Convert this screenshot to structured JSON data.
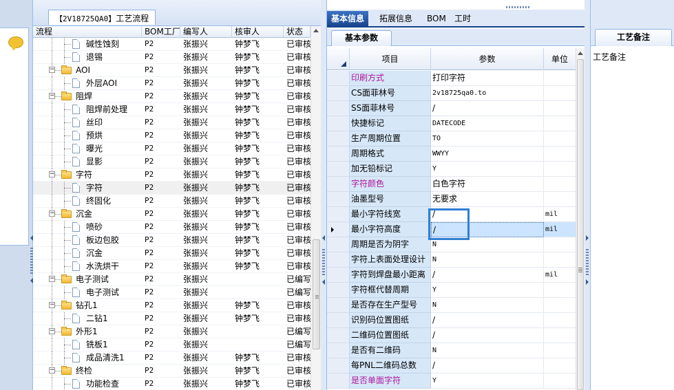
{
  "process_panel": {
    "tab_code": "【2V18725QA0】",
    "tab_label": "工艺流程",
    "columns": [
      "流程",
      "BOM工厂",
      "编写人",
      "核审人",
      "状态"
    ],
    "rows": [
      {
        "name": "碱性蚀刻",
        "type": "doc",
        "bom": "P2",
        "writer": "张振兴",
        "reviewer": "钟梦飞",
        "status": "已审核"
      },
      {
        "name": "退锡",
        "type": "doc",
        "bom": "P2",
        "writer": "张振兴",
        "reviewer": "钟梦飞",
        "status": "已审核"
      },
      {
        "name": "AOI",
        "type": "folder",
        "bom": "P2",
        "writer": "张振兴",
        "reviewer": "钟梦飞",
        "status": "已审核"
      },
      {
        "name": "外层AOI",
        "type": "doc",
        "bom": "P2",
        "writer": "张振兴",
        "reviewer": "钟梦飞",
        "status": "已审核"
      },
      {
        "name": "阻焊",
        "type": "folder",
        "bom": "P2",
        "writer": "张振兴",
        "reviewer": "钟梦飞",
        "status": "已审核"
      },
      {
        "name": "阻焊前处理",
        "type": "doc",
        "bom": "P2",
        "writer": "张振兴",
        "reviewer": "钟梦飞",
        "status": "已审核"
      },
      {
        "name": "丝印",
        "type": "doc",
        "bom": "P2",
        "writer": "张振兴",
        "reviewer": "钟梦飞",
        "status": "已审核"
      },
      {
        "name": "预烘",
        "type": "doc",
        "bom": "P2",
        "writer": "张振兴",
        "reviewer": "钟梦飞",
        "status": "已审核"
      },
      {
        "name": "曝光",
        "type": "doc",
        "bom": "P2",
        "writer": "张振兴",
        "reviewer": "钟梦飞",
        "status": "已审核"
      },
      {
        "name": "显影",
        "type": "doc",
        "bom": "P2",
        "writer": "张振兴",
        "reviewer": "钟梦飞",
        "status": "已审核"
      },
      {
        "name": "字符",
        "type": "folder",
        "bom": "P2",
        "writer": "张振兴",
        "reviewer": "钟梦飞",
        "status": "已审核"
      },
      {
        "name": "字符",
        "type": "doc",
        "bom": "P2",
        "writer": "张振兴",
        "reviewer": "钟梦飞",
        "status": "已审核",
        "selected": true
      },
      {
        "name": "终固化",
        "type": "doc",
        "bom": "P2",
        "writer": "张振兴",
        "reviewer": "钟梦飞",
        "status": "已审核"
      },
      {
        "name": "沉金",
        "type": "folder",
        "bom": "P2",
        "writer": "张振兴",
        "reviewer": "钟梦飞",
        "status": "已审核"
      },
      {
        "name": "喷砂",
        "type": "doc",
        "bom": "P2",
        "writer": "张振兴",
        "reviewer": "钟梦飞",
        "status": "已审核"
      },
      {
        "name": "板边包胶",
        "type": "doc",
        "bom": "P2",
        "writer": "张振兴",
        "reviewer": "钟梦飞",
        "status": "已审核"
      },
      {
        "name": "沉金",
        "type": "doc",
        "bom": "P2",
        "writer": "张振兴",
        "reviewer": "钟梦飞",
        "status": "已审核"
      },
      {
        "name": "水洗烘干",
        "type": "doc",
        "bom": "P2",
        "writer": "张振兴",
        "reviewer": "钟梦飞",
        "status": "已审核"
      },
      {
        "name": "电子测试",
        "type": "folder",
        "bom": "P2",
        "writer": "张振兴",
        "reviewer": "",
        "status": "已编写"
      },
      {
        "name": "电子测试",
        "type": "doc",
        "bom": "P2",
        "writer": "张振兴",
        "reviewer": "",
        "status": "已编写"
      },
      {
        "name": "钻孔1",
        "type": "folder",
        "bom": "P2",
        "writer": "张振兴",
        "reviewer": "钟梦飞",
        "status": "已审核"
      },
      {
        "name": "二钻1",
        "type": "doc",
        "bom": "P2",
        "writer": "张振兴",
        "reviewer": "钟梦飞",
        "status": "已审核"
      },
      {
        "name": "外形1",
        "type": "folder",
        "bom": "P2",
        "writer": "张振兴",
        "reviewer": "",
        "status": "已编写"
      },
      {
        "name": "铣板1",
        "type": "doc",
        "bom": "P2",
        "writer": "张振兴",
        "reviewer": "",
        "status": "已编写"
      },
      {
        "name": "成品清洗1",
        "type": "doc",
        "bom": "P2",
        "writer": "张振兴",
        "reviewer": "钟梦飞",
        "status": "已审核"
      },
      {
        "name": "终检",
        "type": "folder",
        "bom": "P2",
        "writer": "张振兴",
        "reviewer": "钟梦飞",
        "status": "已审核"
      },
      {
        "name": "功能检查",
        "type": "doc",
        "bom": "P2",
        "writer": "张振兴",
        "reviewer": "钟梦飞",
        "status": "已审核"
      }
    ]
  },
  "info_panel": {
    "tabs": [
      "基本信息",
      "拓展信息",
      "BOM",
      "工时"
    ],
    "active_tab": 0,
    "subtab": "基本参数",
    "columns": {
      "item": "项目",
      "param": "参数",
      "unit": "单位"
    },
    "rows": [
      {
        "item": "印刷方式",
        "param": "打印字符",
        "unit": "",
        "pink": true
      },
      {
        "item": "CS面菲林号",
        "param": "2v18725qa0.to",
        "unit": "",
        "mono": true
      },
      {
        "item": "SS面菲林号",
        "param": "/",
        "unit": ""
      },
      {
        "item": "快捷标记",
        "param": "DATECODE",
        "unit": "",
        "mono": true
      },
      {
        "item": "生产周期位置",
        "param": "TO",
        "unit": "",
        "mono": true
      },
      {
        "item": "周期格式",
        "param": "WWYY",
        "unit": "",
        "mono": true
      },
      {
        "item": "加无铅标记",
        "param": "Y",
        "unit": "",
        "mono": true
      },
      {
        "item": "字符颜色",
        "param": "白色字符",
        "unit": "",
        "pink": true
      },
      {
        "item": "油墨型号",
        "param": "无要求",
        "unit": ""
      },
      {
        "item": "最小字符线宽",
        "param": "/",
        "unit": "mil"
      },
      {
        "item": "最小字符高度",
        "param": "/",
        "unit": "mil",
        "current": true
      },
      {
        "item": "周期是否为阴字",
        "param": "N",
        "unit": "",
        "mono": true
      },
      {
        "item": "字符上表面处理设计",
        "param": "N",
        "unit": "",
        "mono": true
      },
      {
        "item": "字符到焊盘最小距离",
        "param": "/",
        "unit": "mil"
      },
      {
        "item": "字符框代替周期",
        "param": "Y",
        "unit": "",
        "mono": true
      },
      {
        "item": "是否存在生产型号",
        "param": "N",
        "unit": "",
        "mono": true
      },
      {
        "item": "识别码位置图纸",
        "param": "/",
        "unit": ""
      },
      {
        "item": "二维码位置图纸",
        "param": "/",
        "unit": ""
      },
      {
        "item": "是否有二维码",
        "param": "N",
        "unit": "",
        "mono": true
      },
      {
        "item": "每PNL二维码总数",
        "param": "/",
        "unit": ""
      },
      {
        "item": "是否单面字符",
        "param": "Y",
        "unit": "",
        "pink": true,
        "mono": true
      }
    ]
  },
  "remarks_panel": {
    "tab": "工艺备注",
    "label": "工艺备注"
  },
  "colors": {
    "active_tab": "#15428b",
    "label_cell": "#d6e7f8",
    "pink_label": "#b0159a",
    "focus_border": "#2f7fd1"
  }
}
